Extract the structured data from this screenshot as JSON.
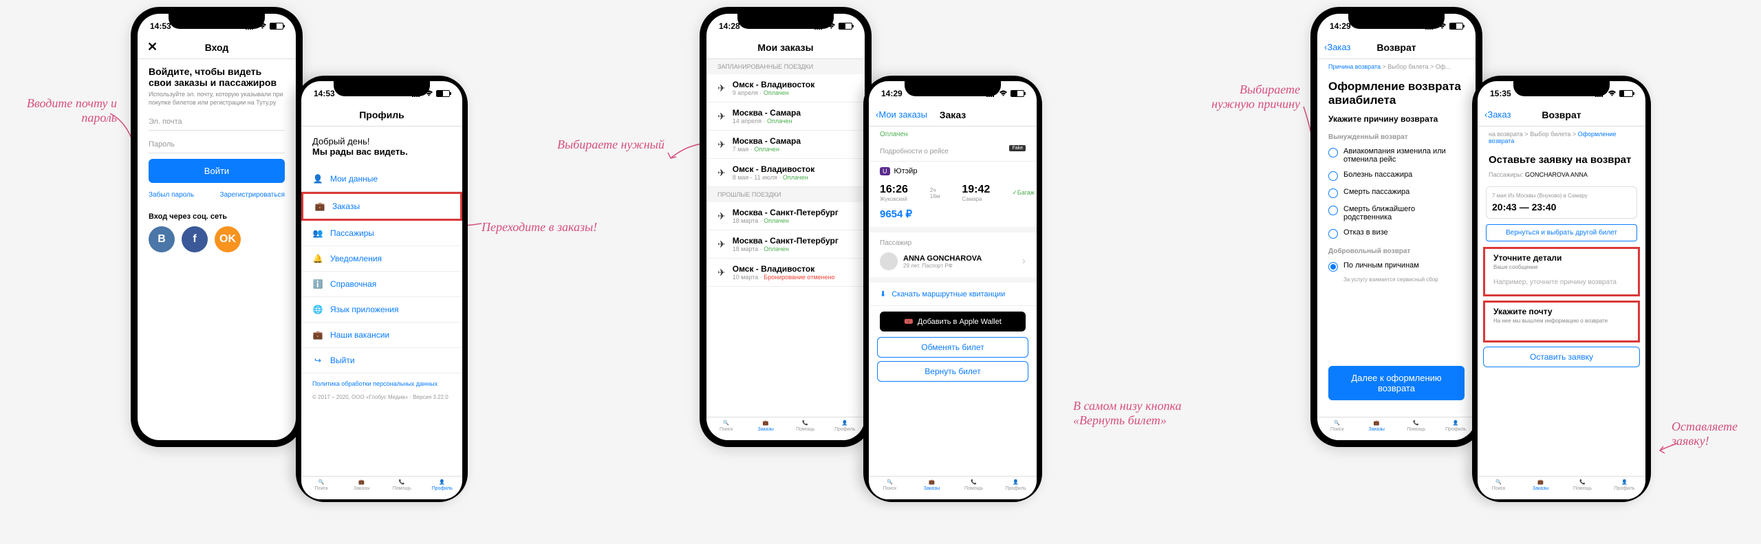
{
  "annotations": {
    "a1": "Вводите почту и пароль",
    "a2": "Переходите в заказы!",
    "a3": "Выбираете нужный",
    "a4": "В самом низу кнопка «Вернуть билет»",
    "a5": "Выбираете нужную причину",
    "a6": "Оставляете заявку!"
  },
  "phone1": {
    "time": "14:53",
    "nav_title": "Вход",
    "heading": "Войдите, чтобы видеть свои заказы и пассажиров",
    "sub": "Используйте эл. почту, которую указывали при покупке билетов или регистрации на Туту.ру",
    "email_ph": "Эл. почта",
    "password_ph": "Пароль",
    "login_btn": "Войти",
    "forgot": "Забыл пароль",
    "register": "Зарегистрироваться",
    "social_label": "Вход через соц. сеть"
  },
  "phone2": {
    "time": "14:53",
    "nav_title": "Профиль",
    "greeting1": "Добрый день!",
    "greeting2": "Мы рады вас видеть.",
    "menu": {
      "data": "Мои данные",
      "orders": "Заказы",
      "passengers": "Пассажиры",
      "notifications": "Уведомления",
      "help": "Справочная",
      "language": "Язык приложения",
      "vacancies": "Наши вакансии",
      "logout": "Выйти"
    },
    "privacy": "Политика обработки персональных данных",
    "copyright": "© 2017 – 2020, ООО «Глобус Медиа» · Версия 3.22.0"
  },
  "phone3": {
    "time": "14:28",
    "nav_title": "Мои заказы",
    "planned": "ЗАПЛАНИРОВАННЫЕ ПОЕЗДКИ",
    "past": "ПРОШЛЫЕ ПОЕЗДКИ",
    "trips": [
      {
        "route": "Омск - Владивосток",
        "meta": "9 апреля",
        "status": "Оплачен",
        "statusClass": "paid"
      },
      {
        "route": "Москва - Самара",
        "meta": "14 апреля",
        "status": "Оплачен",
        "statusClass": "paid"
      },
      {
        "route": "Москва - Самара",
        "meta": "7 мая",
        "status": "Оплачен",
        "statusClass": "paid"
      },
      {
        "route": "Омск - Владивосток",
        "meta": "8 мая - 11 июля",
        "status": "Оплачен",
        "statusClass": "paid"
      }
    ],
    "past_trips": [
      {
        "route": "Москва - Санкт-Петербург",
        "meta": "18 марта",
        "status": "Оплачен",
        "statusClass": "paid"
      },
      {
        "route": "Москва - Санкт-Петербург",
        "meta": "18 марта",
        "status": "Оплачен",
        "statusClass": "paid"
      },
      {
        "route": "Омск - Владивосток",
        "meta": "10 марта",
        "status": "Бронирование отменено",
        "statusClass": "cancelled"
      }
    ]
  },
  "phone4": {
    "time": "14:29",
    "nav_back": "Мои заказы",
    "nav_title": "Заказ",
    "paid": "Оплачен",
    "details": "Подробности о рейсе",
    "airline": "Ютэйр",
    "fake": "Fake",
    "dep_time": "16:26",
    "dep_city": "Жуковский",
    "arr_time": "19:42",
    "arr_city": "Самара",
    "duration": "2ч 16м",
    "baggage": "✓Багаж",
    "price": "9654 ₽",
    "pax_label": "Пассажир",
    "pax_name": "ANNA GONCHAROVA",
    "pax_meta": "29 лет. Паспорт РФ",
    "download": "Скачать маршрутные квитанции",
    "wallet": "Добавить в Apple Wallet",
    "exchange": "Обменять билет",
    "return": "Вернуть билет"
  },
  "phone5": {
    "time": "14:29",
    "nav_back": "Заказ",
    "nav_title": "Возврат",
    "breadcrumb": "Причина возврата > Выбор билета > Оформление",
    "title": "Оформление возврата авиабилета",
    "sub_heading": "Укажите причину возврата",
    "forced": "Вынужденный возврат",
    "reasons": {
      "r1": "Авиакомпания изменила или отменила рейс",
      "r2": "Болезнь пассажира",
      "r3": "Смерть пассажира",
      "r4": "Смерть ближайшего родственника",
      "r5": "Отказ в визе"
    },
    "voluntary": "Добровольный возврат",
    "r6": "По личным причинам",
    "fee_note": "За услугу взимается сервисный сбор",
    "continue": "Далее к оформлению возврата"
  },
  "phone6": {
    "time": "15:35",
    "nav_back": "Заказ",
    "nav_title": "Возврат",
    "breadcrumb": "на возврата > Выбор билета > Оформление возврата",
    "title": "Оставьте заявку на возврат",
    "pax_label": "Пассажиры:",
    "pax_name": "GONCHAROVA ANNA",
    "flight_meta": "7 мая Из Москвы (Внуково) в Самару",
    "times": "20:43 — 23:40",
    "back_btn": "Вернуться и выбрать другой билет",
    "details_heading": "Уточните детали",
    "details_sub": "Ваше сообщение",
    "details_ph": "Например, уточните причину возврата",
    "email_heading": "Укажите почту",
    "email_sub": "На нее мы вышлем информацию о возврате",
    "submit": "Оставить заявку"
  },
  "tabs": {
    "search": "Поиск",
    "orders": "Заказы",
    "help": "Помощь",
    "profile": "Профиль"
  }
}
